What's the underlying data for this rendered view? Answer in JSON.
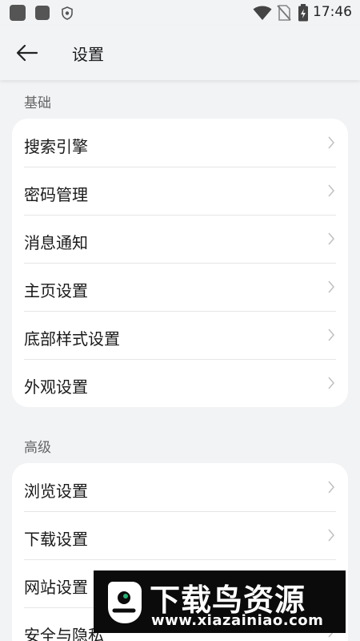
{
  "status_bar": {
    "time": "17:46",
    "icons": [
      "app-icon",
      "sim-icon",
      "shield-icon",
      "wifi-icon",
      "no-sim-icon",
      "battery-icon"
    ]
  },
  "header": {
    "back_icon": "arrow-left-icon",
    "title": "设置"
  },
  "sections": [
    {
      "title": "基础",
      "items": [
        "搜索引擎",
        "密码管理",
        "消息通知",
        "主页设置",
        "底部样式设置",
        "外观设置"
      ]
    },
    {
      "title": "高级",
      "items": [
        "浏览设置",
        "下载设置",
        "网站设置",
        "安全与隐私"
      ]
    }
  ],
  "watermark": {
    "title": "下载鸟资源",
    "url": "www.xiazainiao.com"
  },
  "colors": {
    "background": "#f1f3f5",
    "card": "#ffffff",
    "text": "#1a1a1a",
    "section_text": "#666666",
    "chevron": "#c2c2c2",
    "watermark_bg": "#0b0b0b",
    "logo_accent": "#22b573"
  }
}
